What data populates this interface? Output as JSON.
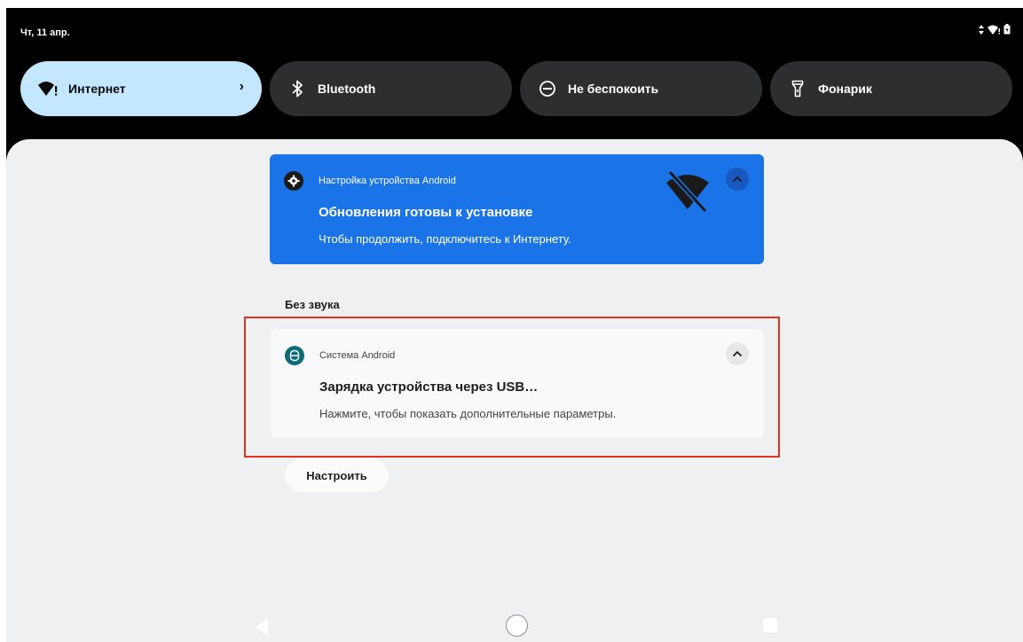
{
  "status": {
    "date": "Чт, 11 апр."
  },
  "quick_settings": [
    {
      "label": "Интернет",
      "icon": "wifi-alert-icon"
    },
    {
      "label": "Bluetooth",
      "icon": "bluetooth-icon"
    },
    {
      "label": "Не беспокоить",
      "icon": "do-not-disturb-icon"
    },
    {
      "label": "Фонарик",
      "icon": "flashlight-icon"
    }
  ],
  "notifications": {
    "update": {
      "app": "Настройка устройства Android",
      "title": "Обновления готовы к установке",
      "text": "Чтобы продолжить, подключитесь к Интернету."
    },
    "silent_label": "Без звука",
    "usb": {
      "app": "Система Android",
      "title": "Зарядка устройства через USB…",
      "text": "Нажмите, чтобы показать дополнительные параметры."
    }
  },
  "settings_button": "Настроить",
  "colors": {
    "active_tile": "#c2e7ff",
    "tile": "#2d2e30",
    "notification_blue": "#1b73e8",
    "highlight": "#e3331f"
  }
}
